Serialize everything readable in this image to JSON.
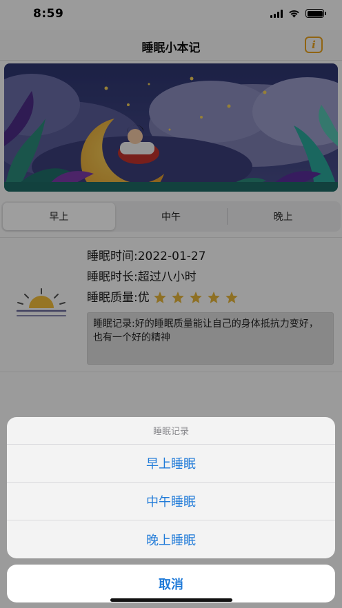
{
  "status": {
    "time": "8:59"
  },
  "nav": {
    "title": "睡眠小本记",
    "info_glyph": "i"
  },
  "tabs": [
    {
      "label": "早上",
      "active": true
    },
    {
      "label": "中午",
      "active": false
    },
    {
      "label": "晚上",
      "active": false
    }
  ],
  "record": {
    "time_line": "睡眠时间:2022-01-27",
    "duration_line": "睡眠时长:超过八小时",
    "quality_line": "睡眠质量:优",
    "quality_stars": 5,
    "note": "睡眠记录:好的睡眠质量能让自己的身体抵抗力变好，也有一个好的精神"
  },
  "action_sheet": {
    "title": "睡眠记录",
    "options": [
      "早上睡眠",
      "中午睡眠",
      "晚上睡眠"
    ],
    "cancel": "取消"
  },
  "colors": {
    "accent": "#1f7ad8",
    "info_icon": "#e8a21d",
    "star": "#e6b53a"
  }
}
